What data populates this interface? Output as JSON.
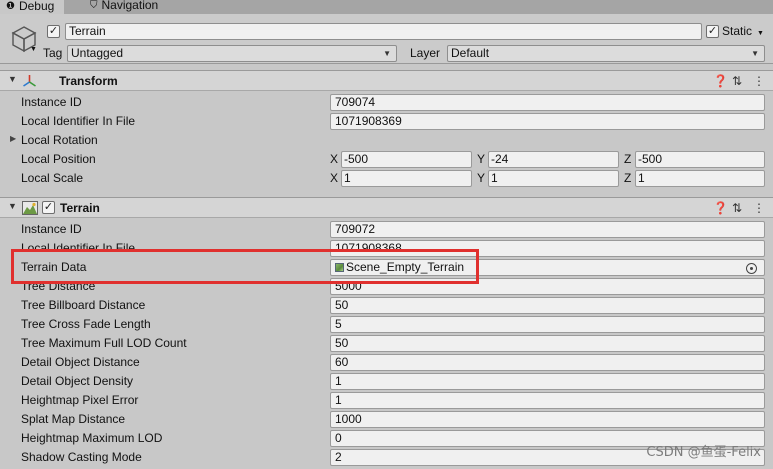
{
  "tabs": [
    {
      "label": "Debug",
      "icon": "info-icon",
      "active": true
    },
    {
      "label": "Navigation",
      "icon": "navigation-icon",
      "active": false
    }
  ],
  "header": {
    "object_active": true,
    "object_name": "Terrain",
    "static_label": "Static",
    "static_checked": true,
    "tag_label": "Tag",
    "tag_value": "Untagged",
    "layer_label": "Layer",
    "layer_value": "Default"
  },
  "transform": {
    "title": "Transform",
    "rows": {
      "instance_id": {
        "label": "Instance ID",
        "value": "709074"
      },
      "local_identifier": {
        "label": "Local Identifier In File",
        "value": "1071908369"
      },
      "local_rotation": {
        "label": "Local Rotation"
      },
      "local_position": {
        "label": "Local Position",
        "x": "-500",
        "y": "-24",
        "z": "-500"
      },
      "local_scale": {
        "label": "Local Scale",
        "x": "1",
        "y": "1",
        "z": "1"
      }
    },
    "axis_labels": {
      "x": "X",
      "y": "Y",
      "z": "Z"
    }
  },
  "terrain": {
    "title": "Terrain",
    "enabled": true,
    "rows": {
      "instance_id": {
        "label": "Instance ID",
        "value": "709072"
      },
      "local_identifier": {
        "label": "Local Identifier In File",
        "value": "1071908368"
      },
      "terrain_data": {
        "label": "Terrain Data",
        "value": "Scene_Empty_Terrain"
      },
      "tree_distance": {
        "label": "Tree Distance",
        "value": "5000"
      },
      "tree_billboard_distance": {
        "label": "Tree Billboard Distance",
        "value": "50"
      },
      "tree_cross_fade_length": {
        "label": "Tree Cross Fade Length",
        "value": "5"
      },
      "tree_max_full_lod_count": {
        "label": "Tree Maximum Full LOD Count",
        "value": "50"
      },
      "detail_object_distance": {
        "label": "Detail Object Distance",
        "value": "60"
      },
      "detail_object_density": {
        "label": "Detail Object Density",
        "value": "1"
      },
      "heightmap_pixel_error": {
        "label": "Heightmap Pixel Error",
        "value": "1"
      },
      "splat_map_distance": {
        "label": "Splat Map Distance",
        "value": "1000"
      },
      "heightmap_maximum_lod": {
        "label": "Heightmap Maximum LOD",
        "value": "0"
      },
      "shadow_casting_mode": {
        "label": "Shadow Casting Mode",
        "value": "2"
      }
    }
  },
  "watermark": "CSDN @鱼蛋-Felix",
  "colors": {
    "highlight": "#e0302e",
    "active_tab": "#3a79bb",
    "panel": "#c8c8c8"
  }
}
